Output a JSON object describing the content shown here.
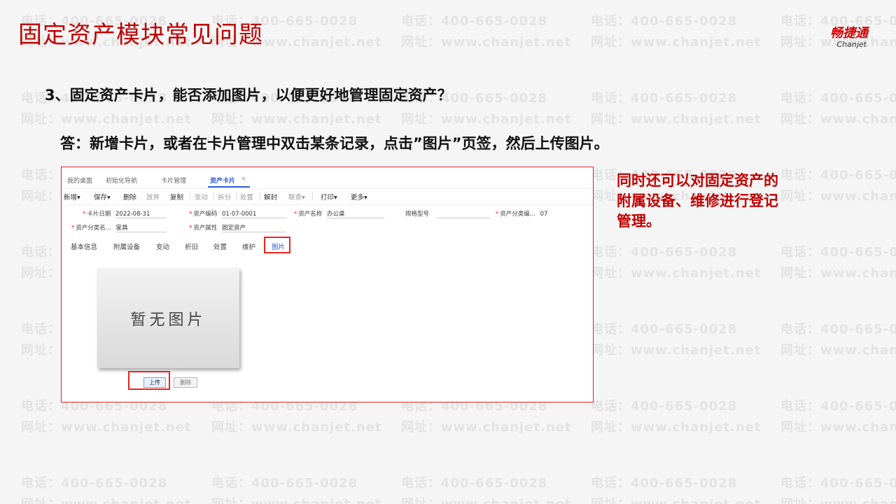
{
  "slide": {
    "title": "固定资产模块常见问题",
    "logo_cn": "畅捷通",
    "logo_en": "Chanjet",
    "question": "3、固定资产卡片，能否添加图片，以便更好地管理固定资产？",
    "answer": "答：新增卡片，或者在卡片管理中双击某条记录，点击”图片”页签，然后上传图片。",
    "note": "同时还可以对固定资产的附属设备、维修进行登记管理。"
  },
  "watermark": {
    "phone": "电话：400-665-0028",
    "site": "网址：www.chanjet.net"
  },
  "app": {
    "tabs": [
      "我的桌面",
      "初始化导航",
      "卡片管理",
      "资产卡片"
    ],
    "active_tab": "资产卡片",
    "tab_close": "×",
    "toolbar": {
      "add": "新增",
      "save": "保存",
      "delete": "删除",
      "discard": "放弃",
      "copy": "复制",
      "change": "变动",
      "split": "拆分",
      "dispose": "处置",
      "unlock": "解封",
      "query": "联查",
      "print": "打印",
      "more": "更多"
    },
    "fields": {
      "card_date_label": "卡片日期",
      "card_date_value": "2022-08-31",
      "asset_code_label": "资产编码",
      "asset_code_value": "01-07-0001",
      "asset_name_label": "资产名称",
      "asset_name_value": "办公桌",
      "spec_label": "规格型号",
      "category_code_label": "资产分类编...",
      "category_code_value": "07",
      "category_name_label": "资产分类名...",
      "category_name_value": "家具",
      "attribute_label": "资产属性",
      "attribute_value": "固定资产"
    },
    "subtabs": [
      "基本信息",
      "附属设备",
      "变动",
      "折旧",
      "处置",
      "维护",
      "图片"
    ],
    "active_subtab": "图片",
    "placeholder_text": "暂无图片",
    "upload_button": "上传",
    "delete_button": "删除"
  }
}
